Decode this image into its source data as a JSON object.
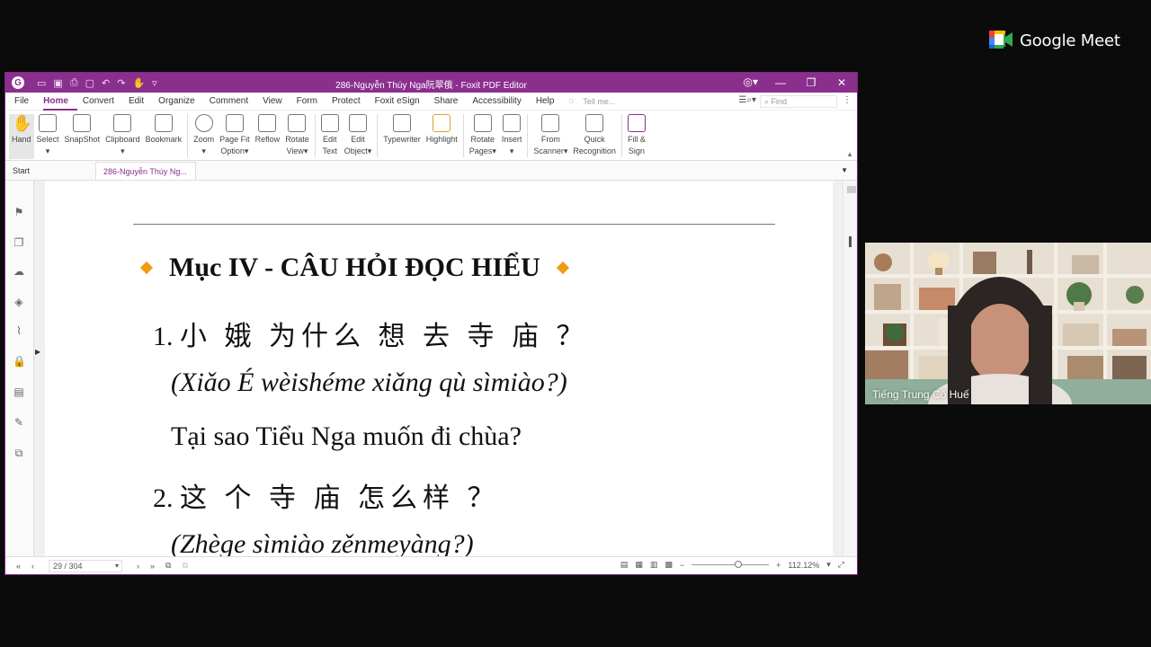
{
  "meet": {
    "brand": "Google Meet",
    "participant_name": "Tiếng Trung Cô Huế"
  },
  "foxit": {
    "title": "286-Nguyễn Thúy Nga阮翠俄 - Foxit PDF Editor",
    "menu": [
      {
        "label": "File"
      },
      {
        "label": "Home"
      },
      {
        "label": "Convert"
      },
      {
        "label": "Edit"
      },
      {
        "label": "Organize"
      },
      {
        "label": "Comment"
      },
      {
        "label": "View"
      },
      {
        "label": "Form"
      },
      {
        "label": "Protect"
      },
      {
        "label": "Foxit eSign"
      },
      {
        "label": "Share"
      },
      {
        "label": "Accessibility"
      },
      {
        "label": "Help"
      }
    ],
    "active_menu": "Home",
    "tell_me_placeholder": "Tell me...",
    "find_placeholder": "Find",
    "ribbon": [
      {
        "l1": "Hand",
        "l2": ""
      },
      {
        "l1": "Select",
        "l2": "▾"
      },
      {
        "l1": "SnapShot",
        "l2": ""
      },
      {
        "l1": "Clipboard",
        "l2": "▾"
      },
      {
        "l1": "Bookmark",
        "l2": ""
      },
      {
        "l1": "Zoom",
        "l2": "▾"
      },
      {
        "l1": "Page Fit",
        "l2": "Option▾"
      },
      {
        "l1": "Reflow",
        "l2": ""
      },
      {
        "l1": "Rotate",
        "l2": "View▾"
      },
      {
        "l1": "Edit",
        "l2": "Text"
      },
      {
        "l1": "Edit",
        "l2": "Object▾"
      },
      {
        "l1": "Typewriter",
        "l2": ""
      },
      {
        "l1": "Highlight",
        "l2": ""
      },
      {
        "l1": "Rotate",
        "l2": "Pages▾"
      },
      {
        "l1": "Insert",
        "l2": "▾"
      },
      {
        "l1": "From",
        "l2": "Scanner▾"
      },
      {
        "l1": "Quick",
        "l2": "Recognition"
      },
      {
        "l1": "Fill &",
        "l2": "Sign"
      }
    ],
    "tabs": {
      "start": "Start",
      "doc": "286-Nguyễn Thúy Ng..."
    },
    "page": {
      "heading": "Mục IV - CÂU HỎI ĐỌC HIỂU",
      "q1_num": "1.",
      "q1_cn": "小 娥 为什么 想 去 寺 庙 ？",
      "q1_pinyin": "(Xiǎo É wèishéme xiǎng qù sìmiào?)",
      "q1_vi": "Tại sao Tiểu Nga muốn đi chùa?",
      "q2_num": "2.",
      "q2_cn": "这 个 寺 庙 怎么样 ？",
      "q2_pinyin": "(Zhège sìmiào zěnmeyàng?)"
    },
    "status": {
      "page": "29 / 304",
      "zoom": "112.12%"
    }
  }
}
